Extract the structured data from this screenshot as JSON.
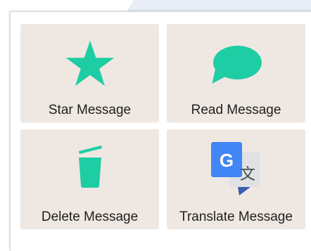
{
  "colors": {
    "accent": "#1fcda5",
    "tile_bg": "#efe8e2",
    "google_blue": "#4285f4",
    "translate_grey": "#dfe1e3",
    "translate_dark_blue": "#3a5fb0"
  },
  "actions": [
    {
      "label": "Star Message",
      "icon": "star-icon"
    },
    {
      "label": "Read Message",
      "icon": "chat-bubble-icon"
    },
    {
      "label": "Delete Message",
      "icon": "trash-icon"
    },
    {
      "label": "Translate Message",
      "icon": "google-translate-icon"
    }
  ],
  "translate_icon": {
    "letter": "G",
    "glyph": "文"
  }
}
